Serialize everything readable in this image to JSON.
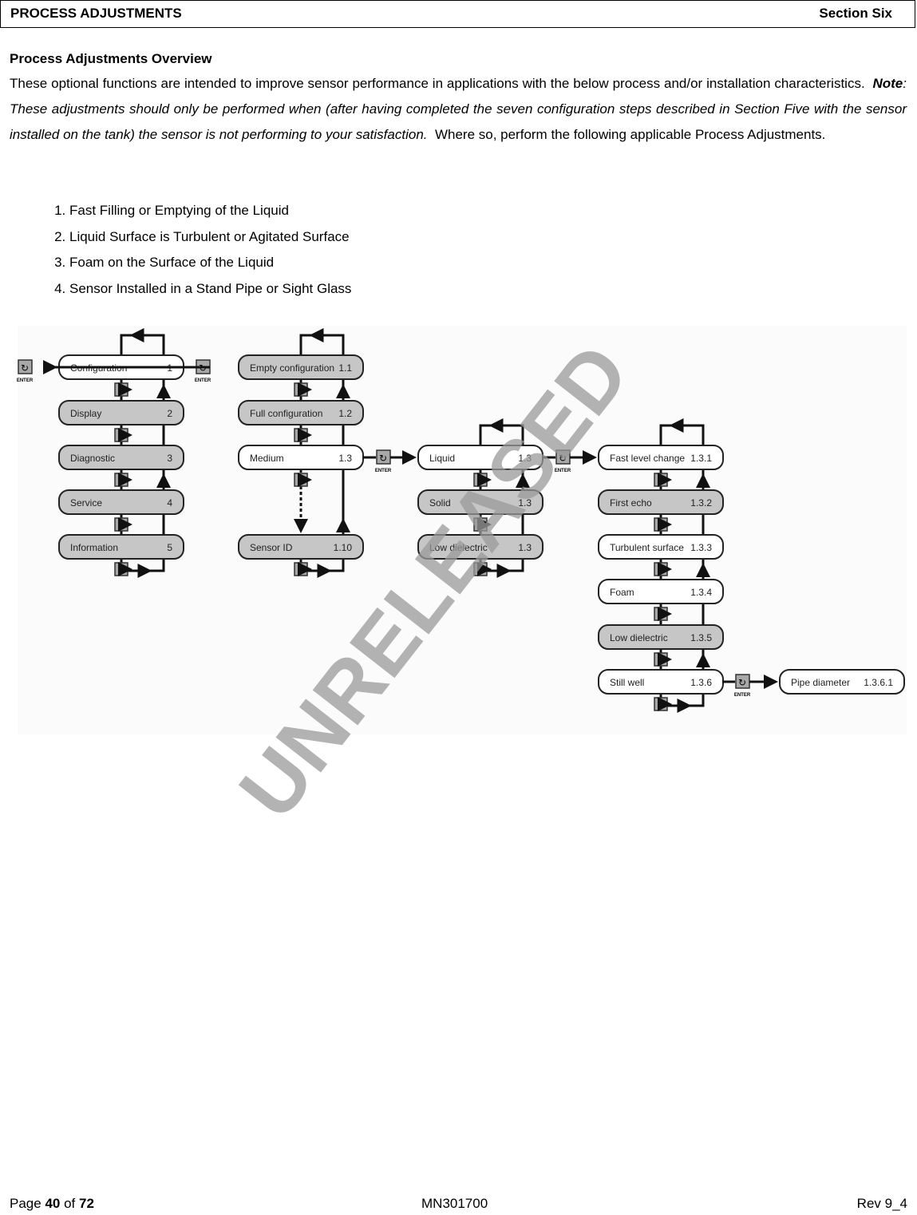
{
  "header": {
    "left": "PROCESS ADJUSTMENTS",
    "right": "Section Six"
  },
  "overview": {
    "title": "Process Adjustments Overview",
    "intro": "These optional functions are intended to improve sensor performance in applications with the below process and/or installation characteristics.",
    "note_label": "Note",
    "note_em": "These adjustments",
    "note_text": " should only be performed when (after having completed the seven configuration steps described in Section Five with the sensor installed on the tank) the sensor is not performing to your satisfaction.",
    "outro": "Where so, perform the following applicable Process Adjustments."
  },
  "list": [
    "Fast Filling or Emptying of the Liquid",
    "Liquid Surface is Turbulent or Agitated Surface",
    "Foam on the Surface of the Liquid",
    "Sensor Installed in a Stand Pipe or Sight Glass"
  ],
  "diagram": {
    "enter_label": "ENTER",
    "columns": [
      [
        {
          "label": "Configuration",
          "code": "1",
          "selected": true
        },
        {
          "label": "Display",
          "code": "2"
        },
        {
          "label": "Diagnostic",
          "code": "3"
        },
        {
          "label": "Service",
          "code": "4"
        },
        {
          "label": "Information",
          "code": "5"
        }
      ],
      [
        {
          "label": "Empty configuration",
          "code": "1.1"
        },
        {
          "label": "Full configuration",
          "code": "1.2"
        },
        {
          "label": "Medium",
          "code": "1.3",
          "selected": true
        },
        {
          "label": "Sensor ID",
          "code": "1.10"
        }
      ],
      [
        {
          "label": "Liquid",
          "code": "1.3",
          "selected": true
        },
        {
          "label": "Solid",
          "code": "1.3"
        },
        {
          "label": "Low dielectric",
          "code": "1.3"
        }
      ],
      [
        {
          "label": "Fast level change",
          "code": "1.3.1",
          "selected": true
        },
        {
          "label": "First echo",
          "code": "1.3.2"
        },
        {
          "label": "Turbulent surface",
          "code": "1.3.3",
          "selected": true
        },
        {
          "label": "Foam",
          "code": "1.3.4",
          "selected": true
        },
        {
          "label": "Low dielectric",
          "code": "1.3.5"
        },
        {
          "label": "Still well",
          "code": "1.3.6",
          "selected": true
        }
      ],
      [
        {
          "label": "Pipe diameter",
          "code": "1.3.6.1",
          "selected": true
        }
      ]
    ],
    "colors": {
      "selected": "#ffffff",
      "unselected": "#c6c6c6",
      "icon": "#a8a8a8"
    }
  },
  "watermark": "UNRELEASED",
  "footer": {
    "page_prefix": "Page ",
    "page": "40",
    "of": " of ",
    "total": "72",
    "doc": "MN301700",
    "rev": "Rev 9_4"
  }
}
